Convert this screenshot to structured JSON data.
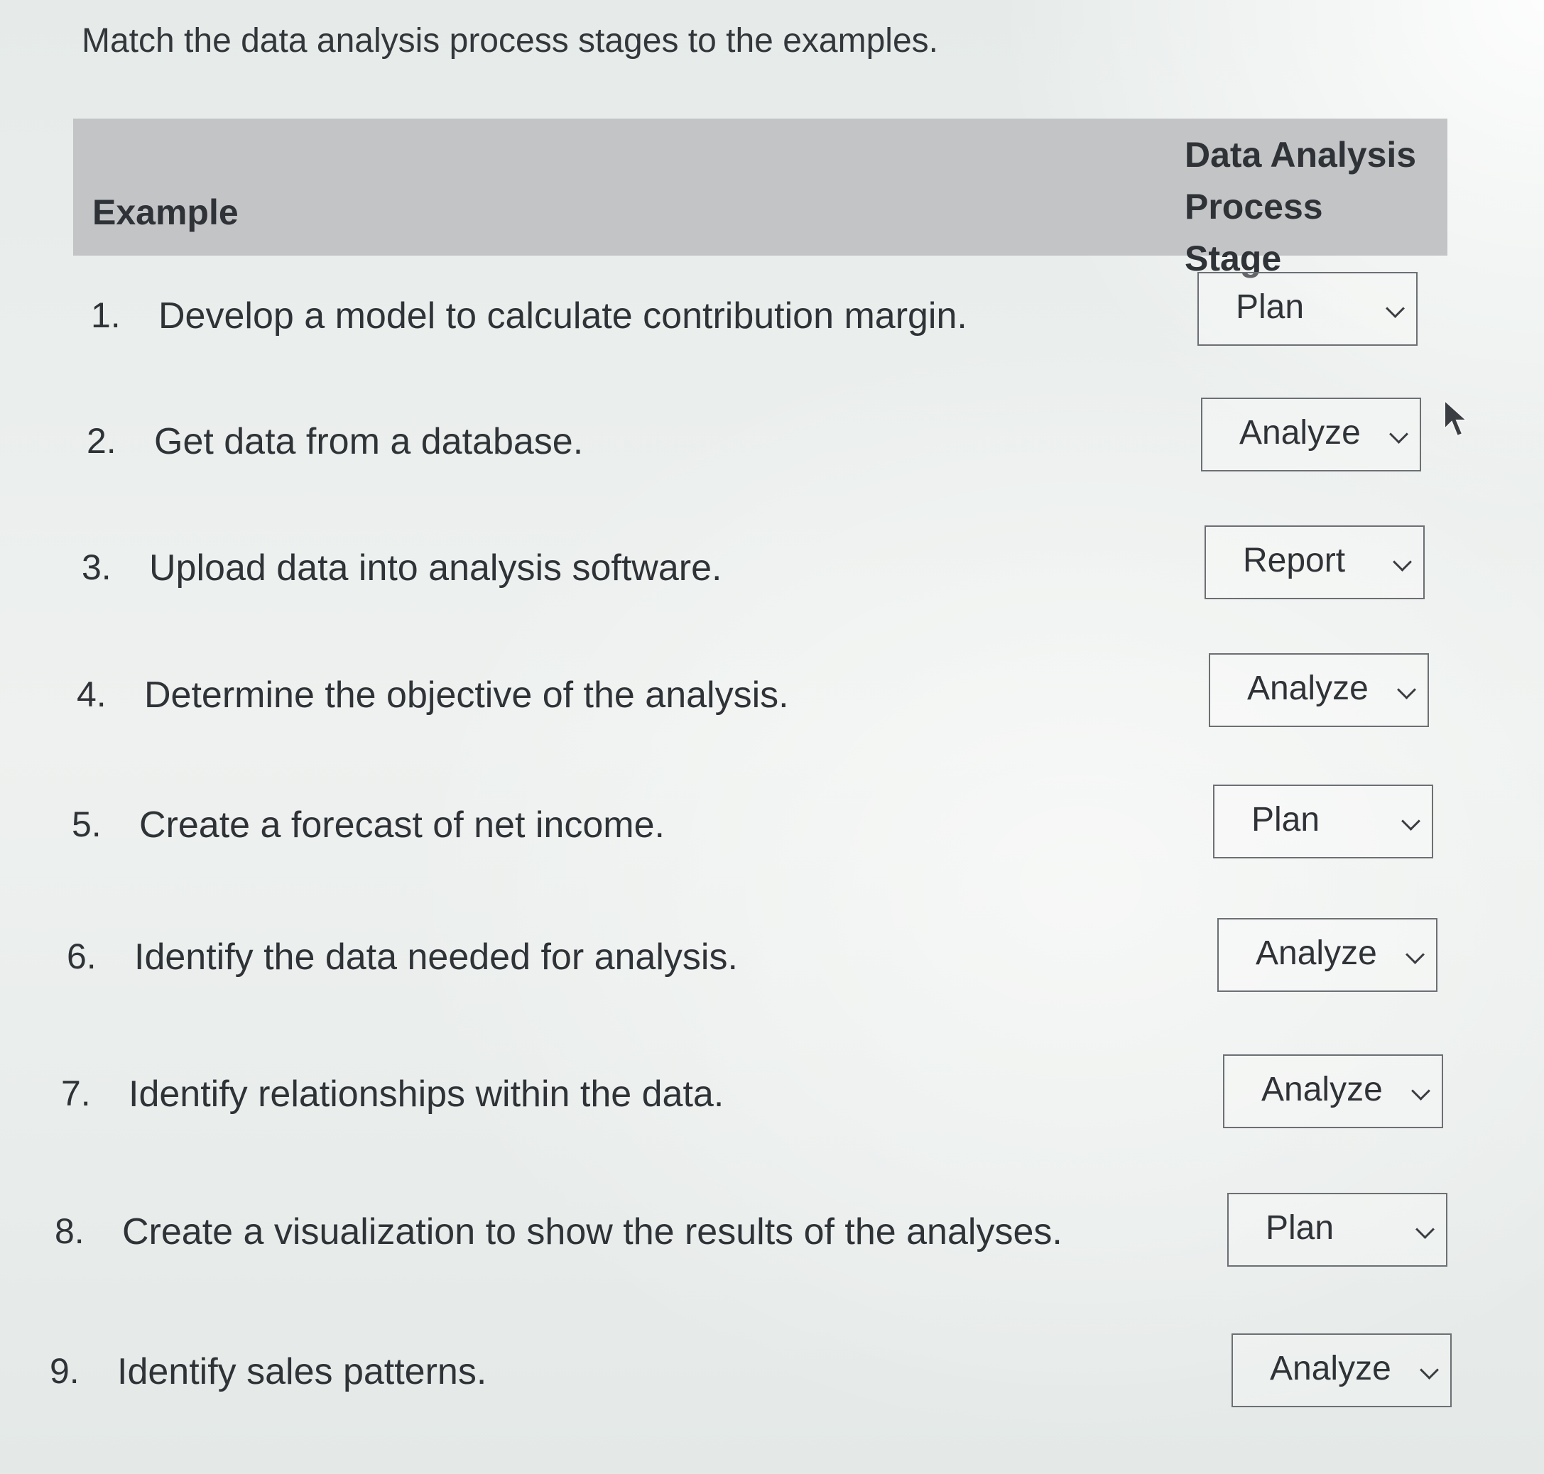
{
  "instruction": "Match the data analysis process stages to the examples.",
  "table": {
    "header_example": "Example",
    "header_stage_line1": "Data Analysis",
    "header_stage_line2": "Process Stage",
    "rows": [
      {
        "num": "1.",
        "text": "Develop a model to calculate contribution margin.",
        "selected": "Plan"
      },
      {
        "num": "2.",
        "text": "Get data from a database.",
        "selected": "Analyze"
      },
      {
        "num": "3.",
        "text": "Upload data into analysis software.",
        "selected": "Report"
      },
      {
        "num": "4.",
        "text": "Determine the objective of the analysis.",
        "selected": "Analyze"
      },
      {
        "num": "5.",
        "text": "Create a forecast of net income.",
        "selected": "Plan"
      },
      {
        "num": "6.",
        "text": "Identify the data needed for analysis.",
        "selected": "Analyze"
      },
      {
        "num": "7.",
        "text": "Identify relationships within the data.",
        "selected": "Analyze"
      },
      {
        "num": "8.",
        "text": "Create a visualization to show the results of the analyses.",
        "selected": "Plan"
      },
      {
        "num": "9.",
        "text": "Identify sales patterns.",
        "selected": "Analyze"
      }
    ]
  },
  "icons": {
    "dropdown": "chevron-down-icon",
    "pointer": "mouse-pointer-icon"
  }
}
